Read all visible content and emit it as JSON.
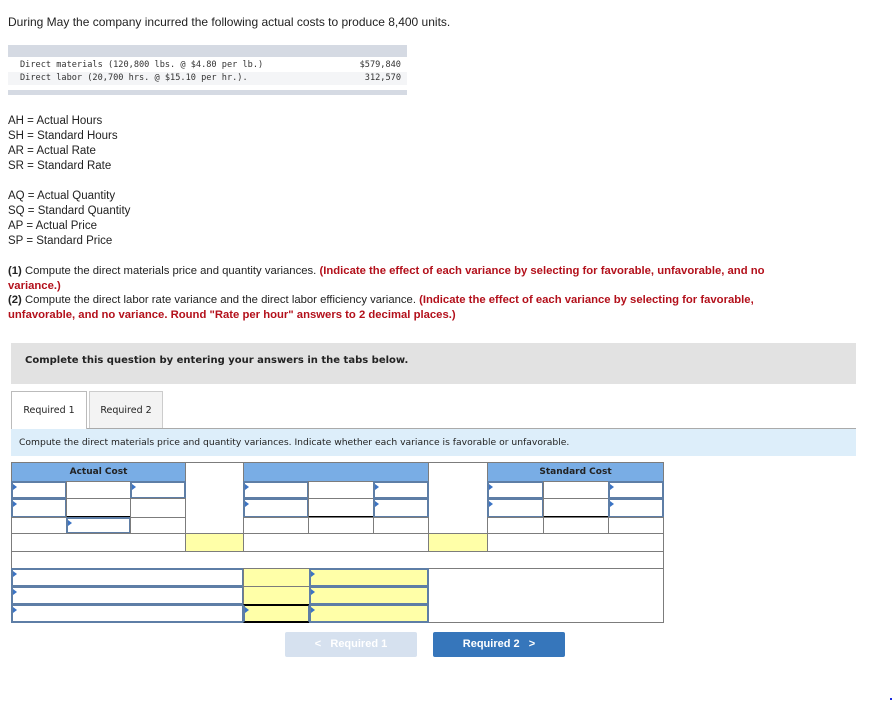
{
  "intro": "During May the company incurred the following actual costs to produce 8,400 units.",
  "actual_costs": [
    {
      "label": "Direct materials (120,800 lbs. @ $4.80 per lb.)",
      "amount": "$579,840"
    },
    {
      "label": "Direct labor (20,700 hrs. @ $15.10 per hr.).",
      "amount": "312,570"
    }
  ],
  "definitions_labor": [
    "AH = Actual Hours",
    "SH = Standard Hours",
    "AR = Actual Rate",
    "SR = Standard Rate"
  ],
  "definitions_materials": [
    "AQ = Actual Quantity",
    "SQ = Standard Quantity",
    "AP = Actual Price",
    "SP = Standard Price"
  ],
  "instructions": {
    "q1_num": "(1)",
    "q1_text": " Compute the direct materials price and quantity variances. ",
    "q1_red": "(Indicate the effect of each variance by selecting for favorable, unfavorable, and no variance.)",
    "q2_num": "(2)",
    "q2_text": " Compute the direct labor rate variance and the direct labor efficiency variance. ",
    "q2_red": "(Indicate the effect of each variance by selecting for favorable, unfavorable, and no variance. Round \"Rate per hour\" answers to 2 decimal places.)"
  },
  "complete_banner": "Complete this question by entering your answers in the tabs below.",
  "tabs": [
    {
      "label": "Required 1",
      "active": true
    },
    {
      "label": "Required 2",
      "active": false
    }
  ],
  "tab_instruction": "Compute the direct materials price and quantity variances. Indicate whether each variance is favorable or unfavorable.",
  "table": {
    "actual_header": "Actual Cost",
    "middle_header": "",
    "standard_header": "Standard Cost"
  },
  "nav": {
    "prev_label": "Required 1",
    "next_label": "Required 2",
    "prev_icon": "chevron-left",
    "next_icon": "chevron-right"
  },
  "colors": {
    "header_blue": "#79ade5",
    "input_yellow": "#ffffa8",
    "instruction_red": "#b3101b",
    "next_button": "#3676bb",
    "prev_button_disabled": "#d6e1ef"
  }
}
